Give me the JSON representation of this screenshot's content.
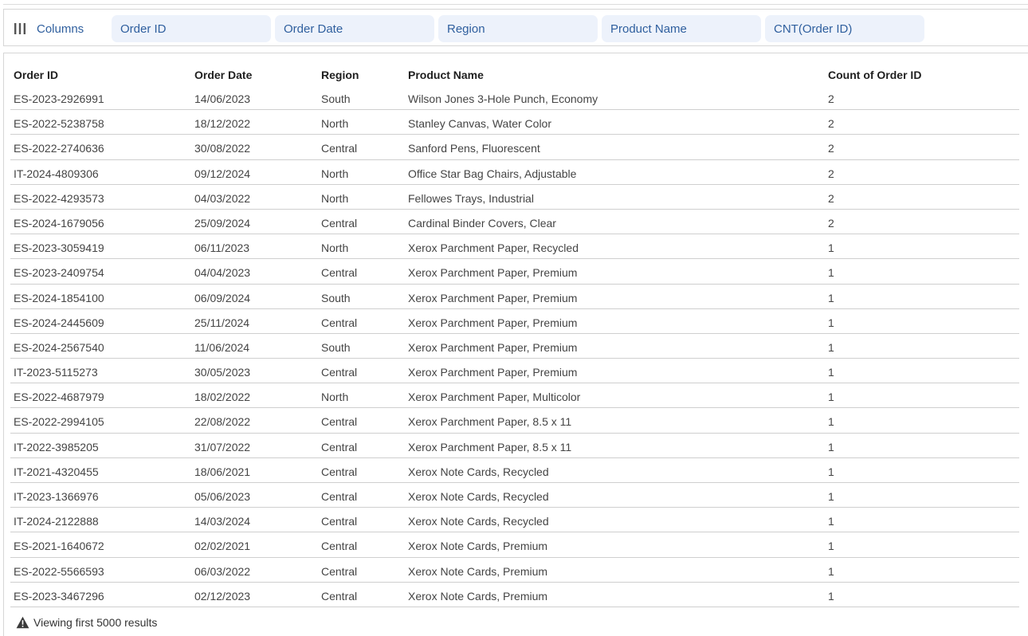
{
  "toolbar": {
    "columns_label": "Columns",
    "columns_icon": "columns-bars-icon",
    "chips": [
      "Order ID",
      "Order Date",
      "Region",
      "Product Name",
      "CNT(Order ID)"
    ]
  },
  "table": {
    "headers": [
      "Order ID",
      "Order Date",
      "Region",
      "Product Name",
      "Count of Order ID"
    ],
    "rows": [
      [
        "ES-2023-2926991",
        "14/06/2023",
        "South",
        "Wilson Jones 3-Hole Punch, Economy",
        "2"
      ],
      [
        "ES-2022-5238758",
        "18/12/2022",
        "North",
        "Stanley Canvas, Water Color",
        "2"
      ],
      [
        "ES-2022-2740636",
        "30/08/2022",
        "Central",
        "Sanford Pens, Fluorescent",
        "2"
      ],
      [
        "IT-2024-4809306",
        "09/12/2024",
        "North",
        "Office Star Bag Chairs, Adjustable",
        "2"
      ],
      [
        "ES-2022-4293573",
        "04/03/2022",
        "North",
        "Fellowes Trays, Industrial",
        "2"
      ],
      [
        "ES-2024-1679056",
        "25/09/2024",
        "Central",
        "Cardinal Binder Covers, Clear",
        "2"
      ],
      [
        "ES-2023-3059419",
        "06/11/2023",
        "North",
        "Xerox Parchment Paper, Recycled",
        "1"
      ],
      [
        "ES-2023-2409754",
        "04/04/2023",
        "Central",
        "Xerox Parchment Paper, Premium",
        "1"
      ],
      [
        "ES-2024-1854100",
        "06/09/2024",
        "South",
        "Xerox Parchment Paper, Premium",
        "1"
      ],
      [
        "ES-2024-2445609",
        "25/11/2024",
        "Central",
        "Xerox Parchment Paper, Premium",
        "1"
      ],
      [
        "ES-2024-2567540",
        "11/06/2024",
        "South",
        "Xerox Parchment Paper, Premium",
        "1"
      ],
      [
        "IT-2023-5115273",
        "30/05/2023",
        "Central",
        "Xerox Parchment Paper, Premium",
        "1"
      ],
      [
        "ES-2022-4687979",
        "18/02/2022",
        "North",
        "Xerox Parchment Paper, Multicolor",
        "1"
      ],
      [
        "ES-2022-2994105",
        "22/08/2022",
        "Central",
        "Xerox Parchment Paper, 8.5 x 11",
        "1"
      ],
      [
        "IT-2022-3985205",
        "31/07/2022",
        "Central",
        "Xerox Parchment Paper, 8.5 x 11",
        "1"
      ],
      [
        "IT-2021-4320455",
        "18/06/2021",
        "Central",
        "Xerox Note Cards, Recycled",
        "1"
      ],
      [
        "IT-2023-1366976",
        "05/06/2023",
        "Central",
        "Xerox Note Cards, Recycled",
        "1"
      ],
      [
        "IT-2024-2122888",
        "14/03/2024",
        "Central",
        "Xerox Note Cards, Recycled",
        "1"
      ],
      [
        "ES-2021-1640672",
        "02/02/2021",
        "Central",
        "Xerox Note Cards, Premium",
        "1"
      ],
      [
        "ES-2022-5566593",
        "06/03/2022",
        "Central",
        "Xerox Note Cards, Premium",
        "1"
      ],
      [
        "ES-2023-3467296",
        "02/12/2023",
        "Central",
        "Xerox Note Cards, Premium",
        "1"
      ]
    ]
  },
  "footer": {
    "text": "Viewing first 5000 results",
    "icon": "warning-icon"
  },
  "colors": {
    "accent_text": "#2f5f9e",
    "chip_background": "#edf2fb",
    "row_divider": "#cfcfcf"
  }
}
